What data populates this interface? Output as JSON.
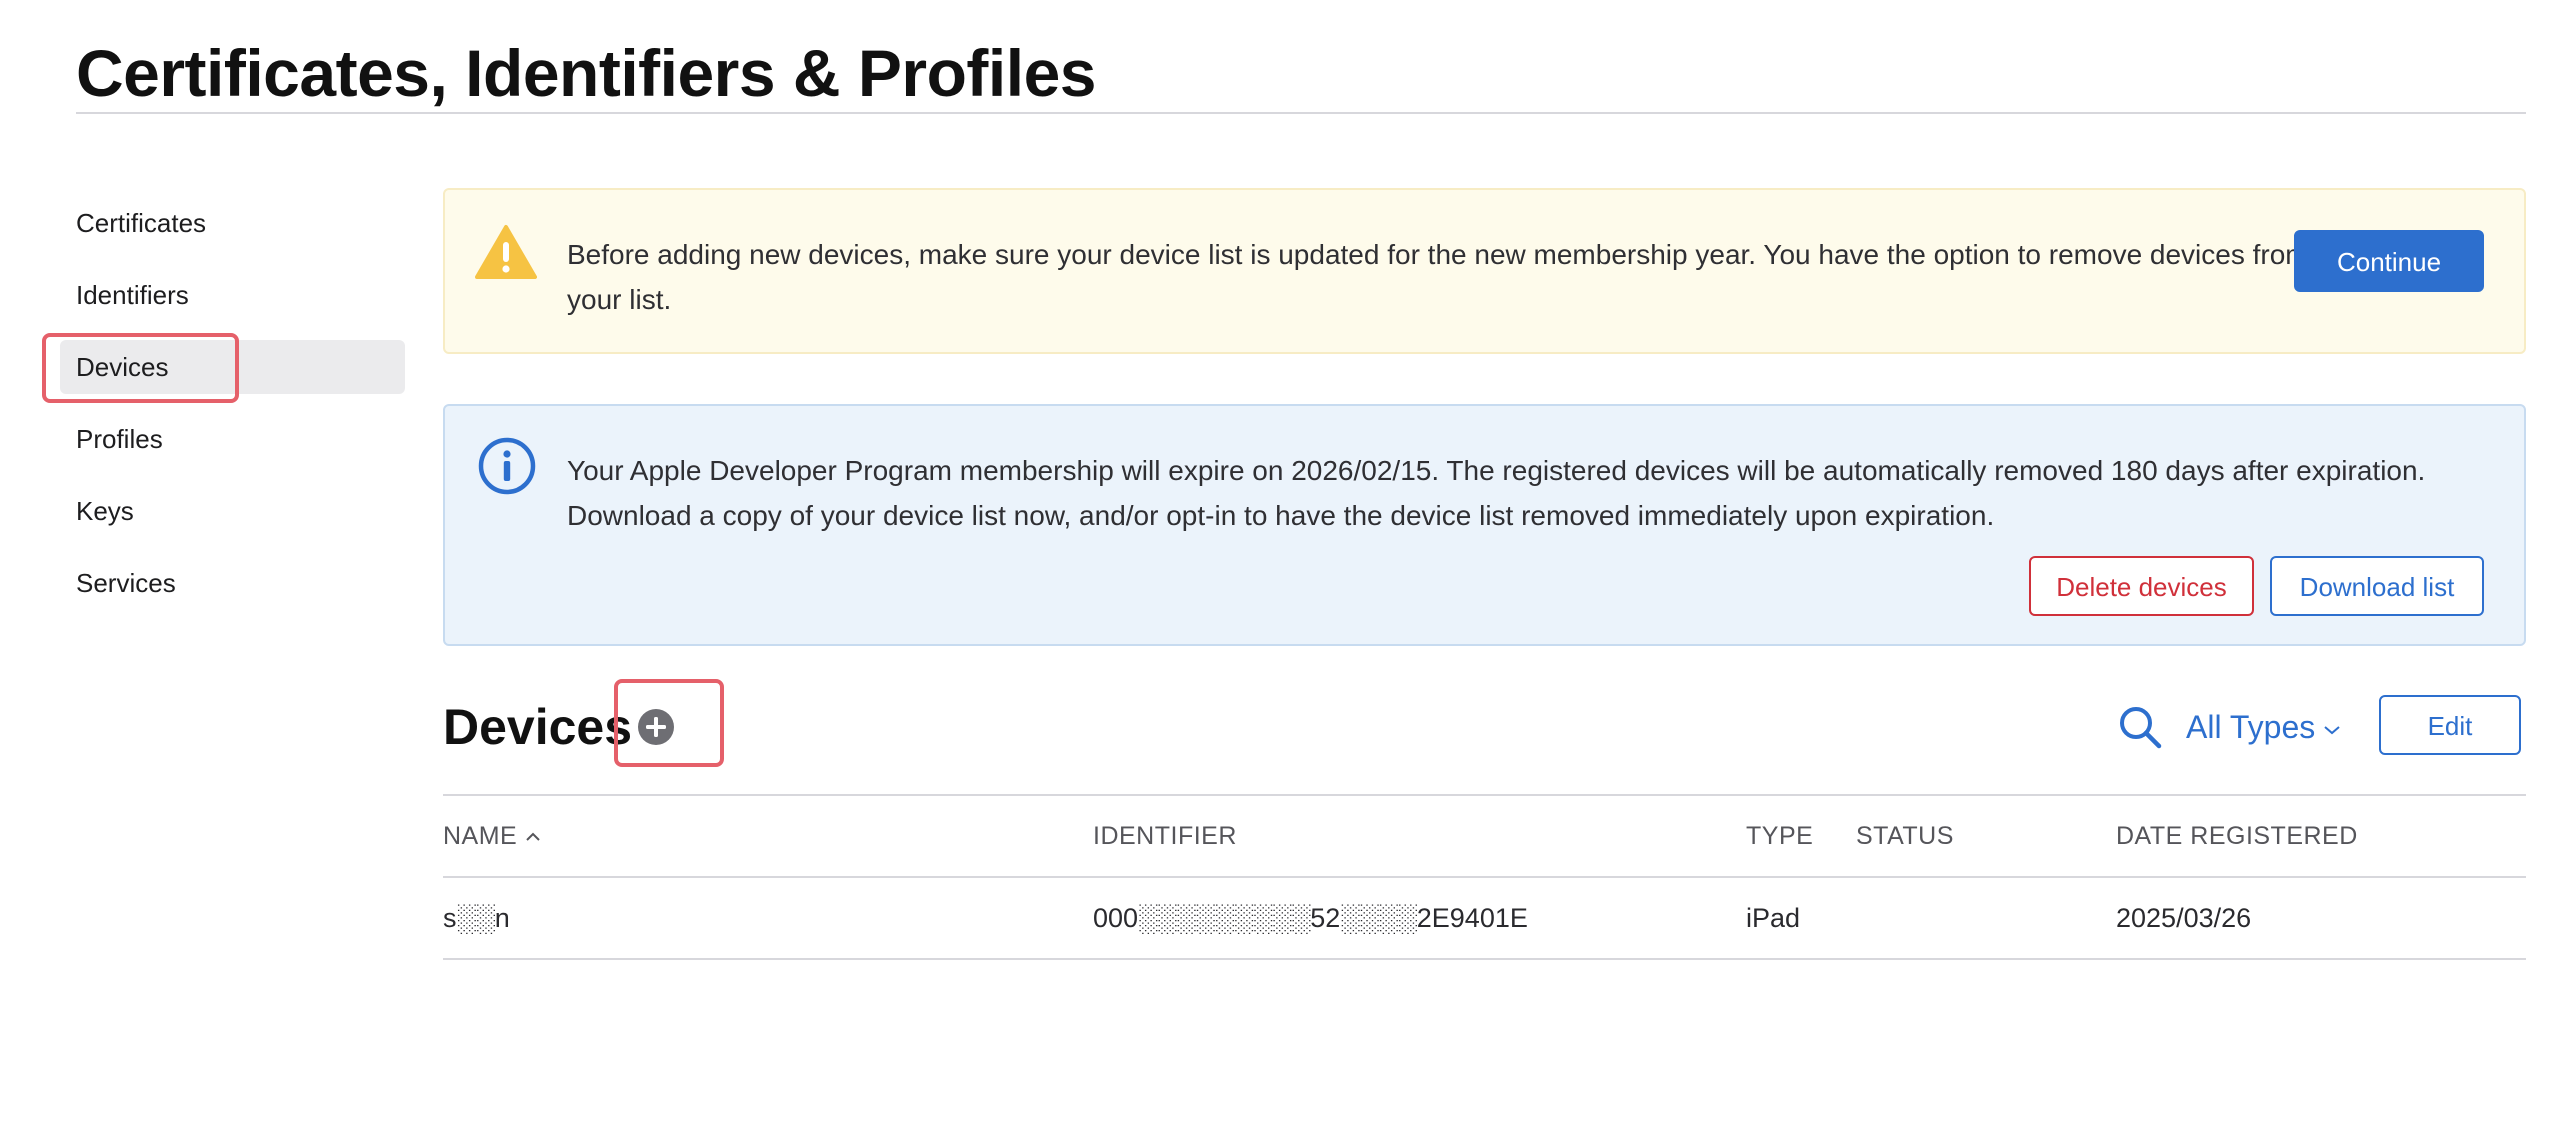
{
  "page": {
    "title": "Certificates, Identifiers & Profiles"
  },
  "sidebar": {
    "items": [
      {
        "label": "Certificates"
      },
      {
        "label": "Identifiers"
      },
      {
        "label": "Devices",
        "active": true
      },
      {
        "label": "Profiles"
      },
      {
        "label": "Keys"
      },
      {
        "label": "Services"
      }
    ]
  },
  "warning_banner": {
    "icon": "warning-triangle-icon",
    "text": "Before adding new devices, make sure your device list is updated for the new membership year. You have the option to remove devices from your list.",
    "continue_label": "Continue"
  },
  "info_banner": {
    "icon": "info-circle-icon",
    "text": "Your Apple Developer Program membership will expire on 2026/02/15. The registered devices will be automatically removed 180 days after expiration. Download a copy of your device list now, and/or opt-in to have the device list removed immediately upon expiration.",
    "delete_label": "Delete devices",
    "download_label": "Download list"
  },
  "devices": {
    "title": "Devices",
    "add_icon": "plus-circle-icon",
    "search_icon": "search-icon",
    "filter_label": "All Types",
    "edit_label": "Edit",
    "columns": {
      "name": "NAME",
      "identifier": "IDENTIFIER",
      "type": "TYPE",
      "status": "STATUS",
      "date": "DATE REGISTERED"
    },
    "sort": {
      "column": "name",
      "direction": "ascending"
    },
    "rows": [
      {
        "name": "s░░n",
        "identifier": "000░░░░░░░░░52░░░░2E9401E",
        "type": "iPad",
        "status": "",
        "date": "2025/03/26"
      }
    ]
  },
  "colors": {
    "accent": "#2d6fce",
    "danger": "#d0303a",
    "warning_bg": "#fefbeb",
    "info_bg": "#ebf3fb",
    "highlight": "#e5606a"
  }
}
